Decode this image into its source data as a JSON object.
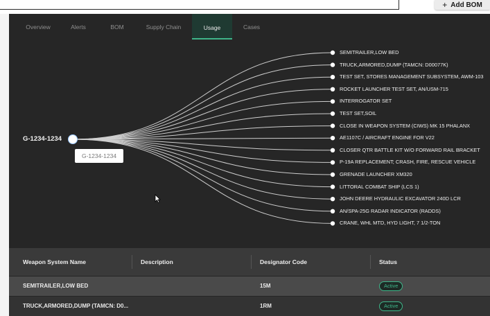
{
  "toolbar": {
    "add_bom_label": "Add BOM"
  },
  "tabs": [
    {
      "label": "Overview",
      "active": false
    },
    {
      "label": "Alerts",
      "active": false
    },
    {
      "label": "BOM",
      "active": false
    },
    {
      "label": "Supply Chain",
      "active": false
    },
    {
      "label": "Usage",
      "active": true
    },
    {
      "label": "Cases",
      "active": false
    }
  ],
  "graph": {
    "root_label": "G-1234-1234",
    "root_tooltip": "G-1234-1234",
    "leaves": [
      "SEMITRAILER,LOW BED",
      "TRUCK,ARMORED,DUMP (TAMCN: D00077K)",
      "TEST SET, STORES MANAGEMENT SUBSYSTEM, AWM-103",
      "ROCKET LAUNCHER TEST SET, AN/USM-715",
      "INTERROGATOR SET",
      "TEST SET,SOIL",
      "CLOSE IN WEAPON SYSTEM (CIWS) MK 15 PHALANX",
      "AE1107C / AIRCRAFT ENGINE FOR V22",
      "CLOSER QTR BATTLE KIT W/O FORWARD RAIL BRACKET",
      "P-19A REPLACEMENT; CRASH, FIRE, RESCUE VEHICLE",
      "GRENADE LAUNCHER XM320",
      "LITTORAL COMBAT SHIP (LCS 1)",
      "JOHN DEERE HYDRAULIC EXCAVATOR 240D LCR",
      "AN/SPA-25G RADAR INDICATOR (RADDS)",
      "CRANE, WHL MTD, HYD LIGHT, 7 1/2-TON"
    ]
  },
  "table": {
    "headers": {
      "name": "Weapon System Name",
      "description": "Description",
      "code": "Designator Code",
      "status": "Status"
    },
    "rows": [
      {
        "name": "SEMITRAILER,LOW BED",
        "description": "",
        "code": "15M",
        "status": "Active"
      },
      {
        "name": "TRUCK,ARMORED,DUMP (TAMCN: D0...",
        "description": "",
        "code": "1RM",
        "status": "Active"
      }
    ]
  },
  "colors": {
    "accent": "#3fb68a",
    "panel_bg": "#262626",
    "active_tab_bg": "#1f3a32"
  },
  "icons": {
    "add": "plus-icon",
    "cursor": "mouse-pointer-icon"
  }
}
